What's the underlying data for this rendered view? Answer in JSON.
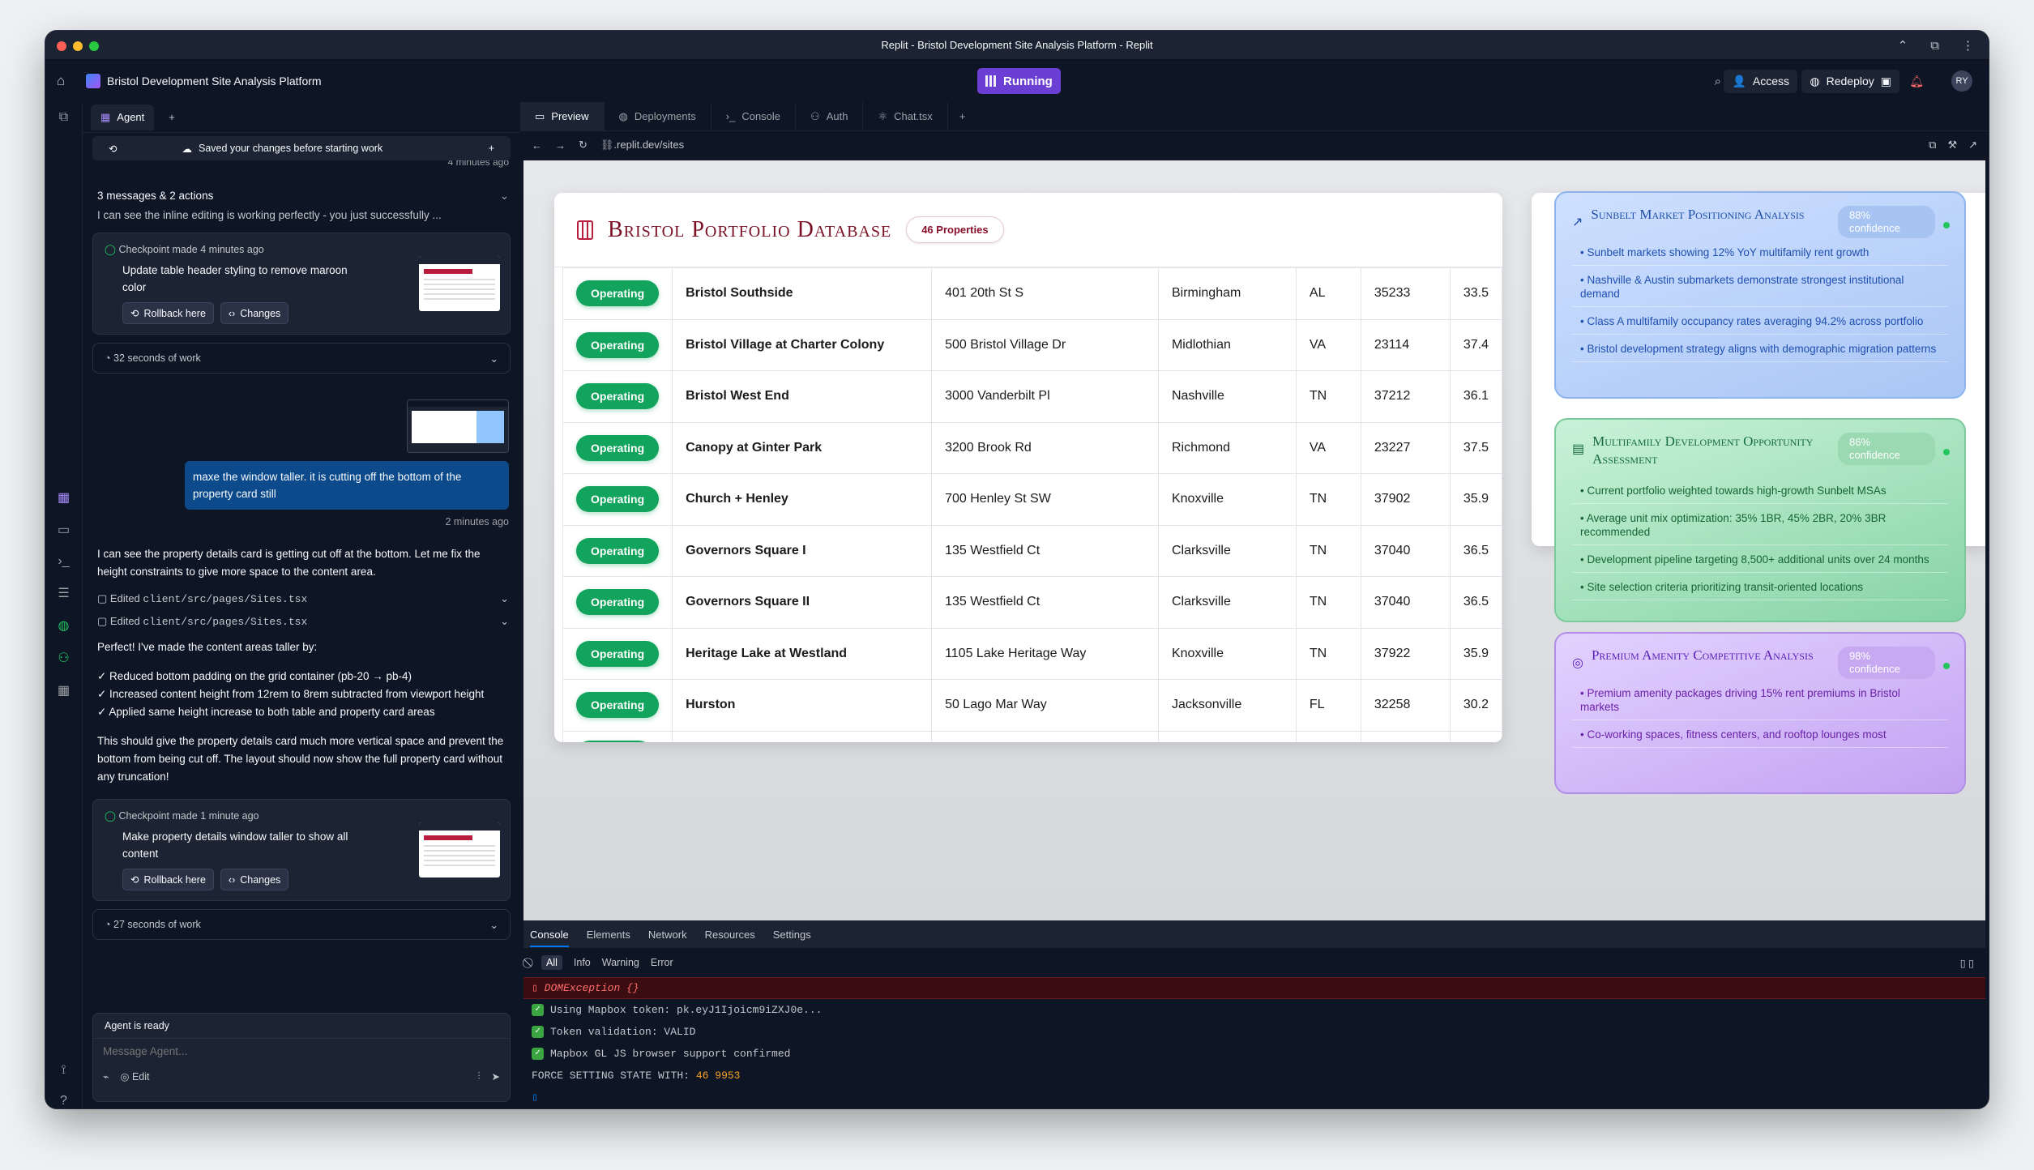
{
  "window": {
    "title": "Replit - Bristol Development Site Analysis Platform - Replit"
  },
  "topbar": {
    "project_name": "Bristol Development Site Analysis Platform",
    "run_label": "Running",
    "access_label": "Access",
    "redeploy_label": "Redeploy",
    "avatar": "RY"
  },
  "agent_panel": {
    "tab_label": "Agent",
    "saved_banner": "Saved your changes before starting work",
    "time_faded": "4 minutes ago",
    "summary_header": "3 messages & 2 actions",
    "summary_text": "I can see the inline editing is working perfectly - you just successfully ...",
    "checkpoint1": {
      "meta": "Checkpoint made 4 minutes ago",
      "text": "Update table header styling to remove maroon color",
      "rollback": "Rollback here",
      "changes": "Changes"
    },
    "work1": "32 seconds of work",
    "user_message": "maxe the window taller. it is cutting off the bottom of the property card still",
    "user_time": "2 minutes ago",
    "reply1": "I can see the property details card is getting cut off at the bottom. Let me fix the height constraints to give more space to the content area.",
    "edited1": "Edited ",
    "edited_file": "client/src/pages/Sites.tsx",
    "reply2": "Perfect! I've made the content areas taller by:",
    "bullets": [
      "✓ Reduced bottom padding on the grid container (pb-20 → pb-4)",
      "✓ Increased content height from 12rem to 8rem subtracted from viewport height",
      "✓ Applied same height increase to both table and property card areas"
    ],
    "reply3": "This should give the property details card much more vertical space and prevent the bottom from being cut off. The layout should now show the full property card without any truncation!",
    "checkpoint2": {
      "meta": "Checkpoint made 1 minute ago",
      "text": "Make property details window taller to show all content",
      "rollback": "Rollback here",
      "changes": "Changes"
    },
    "work2": "27 seconds of work",
    "status": "Agent is ready",
    "input_placeholder": "Message Agent...",
    "edit_label": "Edit"
  },
  "main_tabs": [
    "Preview",
    "Deployments",
    "Console",
    "Auth",
    "Chat.tsx"
  ],
  "url": ".replit.dev/sites",
  "table": {
    "title": "Bristol Portfolio Database",
    "count_badge": "46 Properties",
    "rows": [
      {
        "status": "Operating",
        "name": "Bristol Southside",
        "address": "401 20th St S",
        "city": "Birmingham",
        "state": "AL",
        "zip": "35233",
        "lat": "33.5"
      },
      {
        "status": "Operating",
        "name": "Bristol Village at Charter Colony",
        "address": "500 Bristol Village Dr",
        "city": "Midlothian",
        "state": "VA",
        "zip": "23114",
        "lat": "37.4"
      },
      {
        "status": "Operating",
        "name": "Bristol West End",
        "address": "3000 Vanderbilt Pl",
        "city": "Nashville",
        "state": "TN",
        "zip": "37212",
        "lat": "36.1"
      },
      {
        "status": "Operating",
        "name": "Canopy at Ginter Park",
        "address": "3200 Brook Rd",
        "city": "Richmond",
        "state": "VA",
        "zip": "23227",
        "lat": "37.5"
      },
      {
        "status": "Operating",
        "name": "Church + Henley",
        "address": "700 Henley St SW",
        "city": "Knoxville",
        "state": "TN",
        "zip": "37902",
        "lat": "35.9"
      },
      {
        "status": "Operating",
        "name": "Governors Square I",
        "address": "135 Westfield Ct",
        "city": "Clarksville",
        "state": "TN",
        "zip": "37040",
        "lat": "36.5"
      },
      {
        "status": "Operating",
        "name": "Governors Square II",
        "address": "135 Westfield Ct",
        "city": "Clarksville",
        "state": "TN",
        "zip": "37040",
        "lat": "36.5"
      },
      {
        "status": "Operating",
        "name": "Heritage Lake at Westland",
        "address": "1105 Lake Heritage Way",
        "city": "Knoxville",
        "state": "TN",
        "zip": "37922",
        "lat": "35.9"
      },
      {
        "status": "Operating",
        "name": "Hurston",
        "address": "50 Lago Mar Way",
        "city": "Jacksonville",
        "state": "FL",
        "zip": "32258",
        "lat": "30.2"
      }
    ]
  },
  "insights": [
    {
      "title": "Sunbelt Market Positioning Analysis",
      "confidence": "88% confidence",
      "items": [
        "• Sunbelt markets showing 12% YoY multifamily rent growth",
        "• Nashville & Austin submarkets demonstrate strongest institutional demand",
        "• Class A multifamily occupancy rates averaging 94.2% across portfolio",
        "• Bristol development strategy aligns with demographic migration patterns"
      ]
    },
    {
      "title": "Multifamily Development Opportunity Assessment",
      "confidence": "86% confidence",
      "items": [
        "• Current portfolio weighted towards high-growth Sunbelt MSAs",
        "• Average unit mix optimization: 35% 1BR, 45% 2BR, 20% 3BR recommended",
        "• Development pipeline targeting 8,500+ additional units over 24 months",
        "• Site selection criteria prioritizing transit-oriented locations"
      ]
    },
    {
      "title": "Premium Amenity Competitive Analysis",
      "confidence": "98% confidence",
      "items": [
        "• Premium amenity packages driving 15% rent premiums in Bristol markets",
        "• Co-working spaces, fitness centers, and rooftop lounges most"
      ]
    }
  ],
  "devtools": {
    "tabs": [
      "Console",
      "Elements",
      "Network",
      "Resources",
      "Settings"
    ],
    "filters": [
      "All",
      "Info",
      "Warning",
      "Error"
    ],
    "logs": [
      "DOMException {}",
      "Using Mapbox token: pk.eyJ1Ijoicm9iZXJ0e...",
      "Token validation: VALID",
      "Mapbox GL JS browser support confirmed"
    ],
    "force_prefix": "FORCE SETTING STATE WITH:",
    "force_values": "46 9953"
  },
  "colors": {
    "accent": "#7a0f23",
    "status_green": "#12a35c",
    "run_purple": "#6b3fd4"
  }
}
